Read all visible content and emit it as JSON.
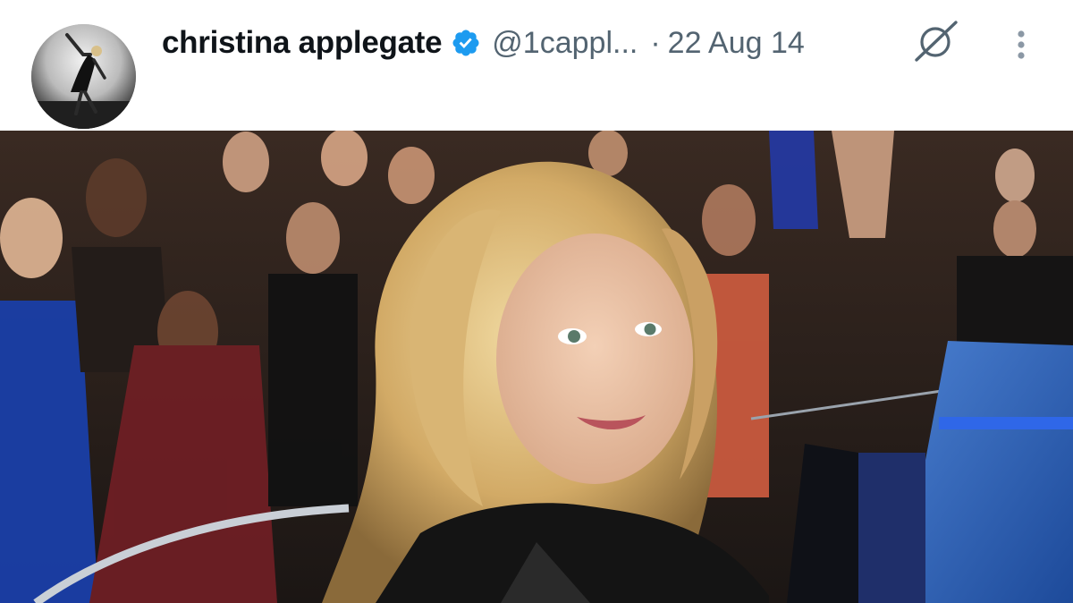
{
  "tweet": {
    "author": {
      "display_name": "christina applegate",
      "handle": "@1cappl...",
      "verified": true,
      "avatar_icon": "avatar-image"
    },
    "separator": "·",
    "date": "22 Aug 14",
    "icons": {
      "verified": "verified-badge-icon",
      "grok": "grok-icon",
      "more": "more-options-icon"
    },
    "colors": {
      "verified_blue": "#1d9bf0",
      "name_text": "#0f1419",
      "meta_text": "#536471"
    },
    "media": {
      "type": "photo"
    }
  }
}
